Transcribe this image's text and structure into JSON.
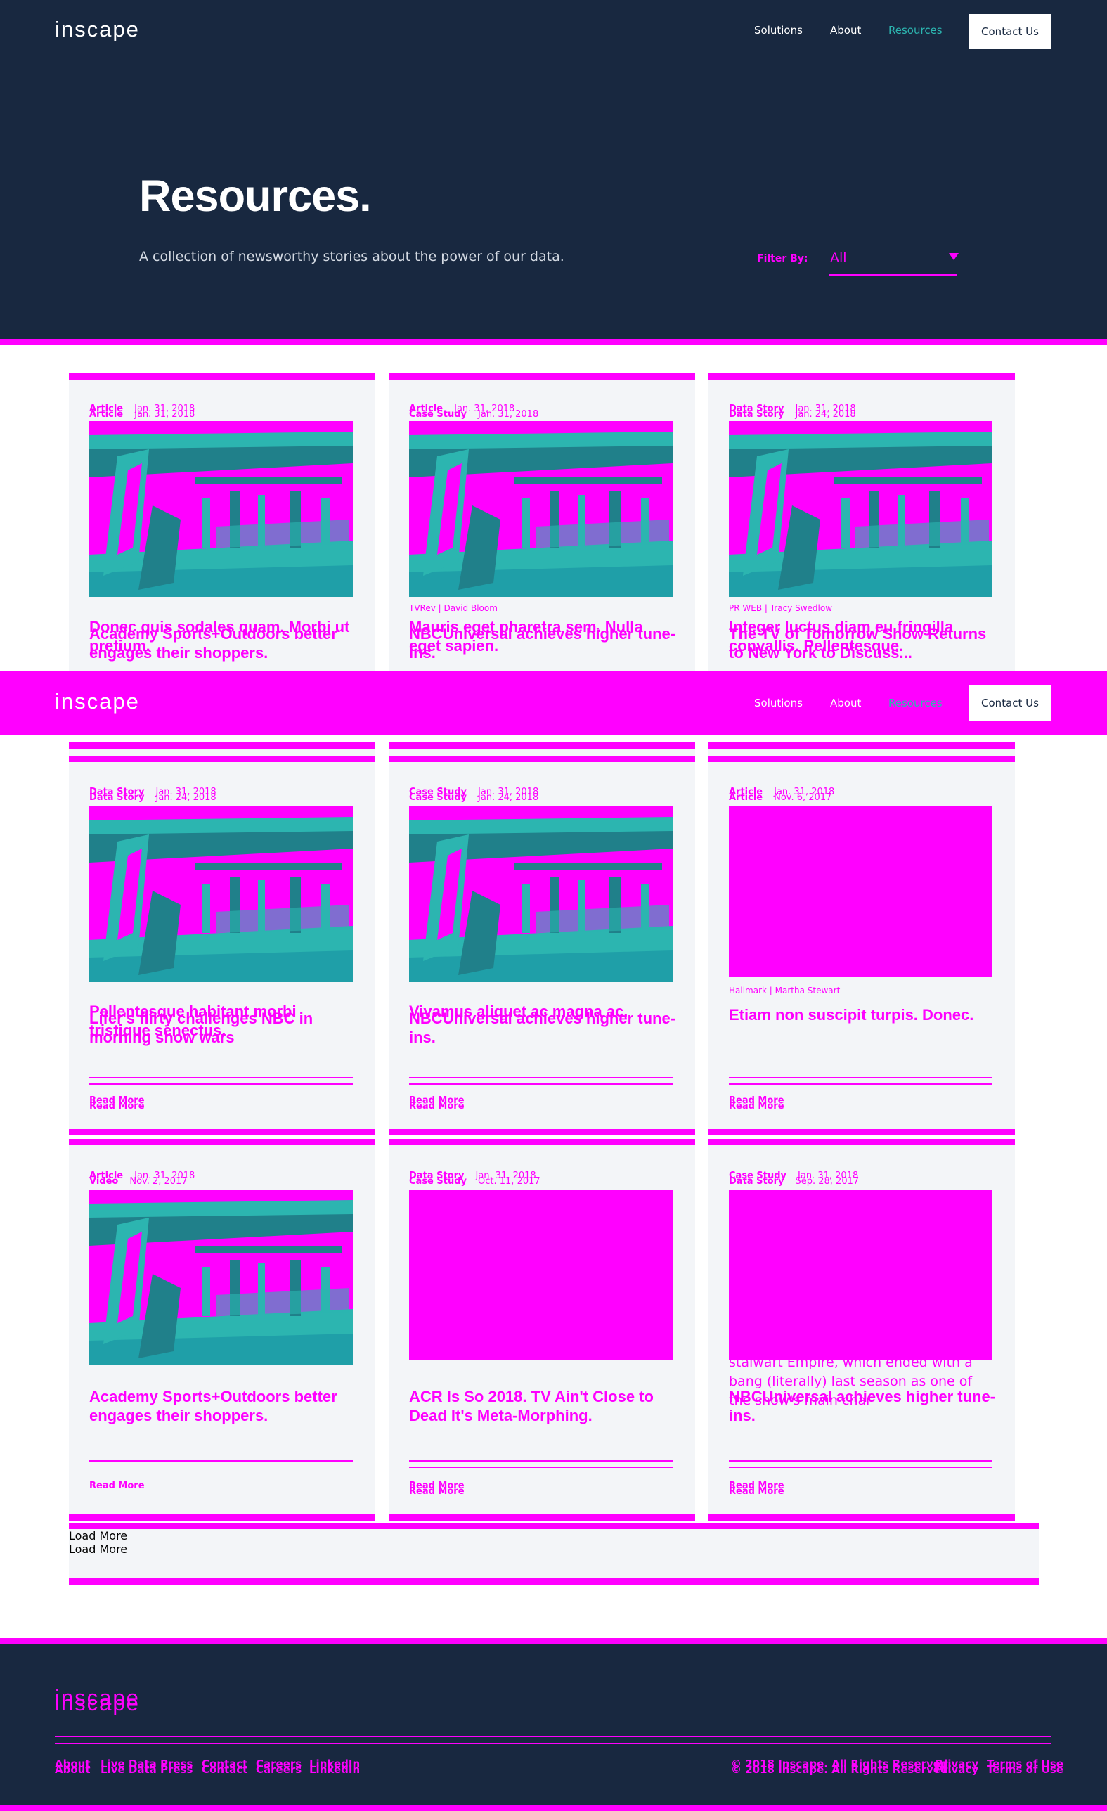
{
  "header": {
    "logo": "inscape",
    "nav": [
      "Solutions",
      "About",
      "Resources"
    ],
    "contact_button": "Contact Us",
    "title": "Resources.",
    "subtitle": "A collection of newsworthy stories about the power of our data.",
    "filter_label": "Filter By:",
    "filter_value": "All"
  },
  "cards": [
    {
      "meta_a": "Article",
      "date_a": "Jan. 31, 2018",
      "meta_b": "Article",
      "date_b": "Jan. 31, 2018",
      "source": "",
      "title_a": "Donec quis sodales quam. Morbi ut pretium.",
      "title_b": "Academy Sports+Outdoors better engages their shoppers."
    },
    {
      "meta_a": "Article",
      "date_a": "Jan. 31, 2018",
      "meta_b": "Case Study",
      "date_b": "Jan. 31, 2018",
      "source": "TVRev | David Bloom",
      "title_a": "Mauris eget pharetra sem. Nulla eget sapien.",
      "title_b": "NBCUniversal achieves higher tune-ins."
    },
    {
      "meta_a": "Data Story",
      "date_a": "Jan. 31, 2018",
      "meta_b": "Data Story",
      "date_b": "Jan. 24, 2018",
      "source": "PR WEB | Tracy Swedlow",
      "title_a": "Integer luctus diam eu fringilla convallis. Pellentesque.",
      "title_b": "The TV of Tomorrow Show Returns to New York to Discuss..."
    },
    {
      "meta_a": "Data Story",
      "date_a": "Jan. 31, 2018",
      "meta_b": "Data Story",
      "date_b": "Jan. 24, 2018",
      "source": "",
      "title_a": "Pellentesque habitant morbi tristique senectus.",
      "title_b": "Lifer's flirty challenges NBC in morning show wars"
    },
    {
      "meta_a": "Case Study",
      "date_a": "Jan. 31, 2018",
      "meta_b": "Case Study",
      "date_b": "Jan. 24, 2018",
      "source": "",
      "title_a": "Vivamus aliquet ac magna ac.",
      "title_b": "NBCUniversal achieves higher tune-ins."
    },
    {
      "meta_a": "Article",
      "date_a": "Jan. 31, 2018",
      "meta_b": "Article",
      "date_b": "Nov. 6, 2017",
      "source": "Hallmark | Martha Stewart",
      "title_a": "Etiam non suscipit turpis. Donec.",
      "title_b": ""
    },
    {
      "meta_a": "Article",
      "date_a": "Jan. 31, 2018",
      "meta_b": "Video",
      "date_b": "Nov. 2, 2017",
      "source": "",
      "title_a": "Academy Sports+Outdoors better engages their shoppers.",
      "title_b": ""
    },
    {
      "meta_a": "Data Story",
      "date_a": "Jan. 31, 2018",
      "meta_b": "Case Study",
      "date_b": "Oct. 11, 2017",
      "source": "",
      "title_a": "ACR Is So 2018. TV Ain't Close to Dead It's Meta-Morphing.",
      "title_b": ""
    },
    {
      "meta_a": "Case Study",
      "date_a": "Jan. 31, 2018",
      "meta_b": "Data Story",
      "date_b": "Sep. 28, 2017",
      "source": "",
      "title_a": "NBCUniversal achieves higher tune-ins.",
      "title_b": "",
      "excerpt": "stalwart Empire, which ended with a bang (literally) last season as one of the show's main char"
    }
  ],
  "read_more": "Read More",
  "load_more": "Load More",
  "footer": {
    "logo": "inscape",
    "links": [
      "About",
      "Live Data",
      "Press",
      "Contact",
      "Careers",
      "LinkedIn"
    ],
    "copyright": "© 2018 Inscape. All Rights Reserved.",
    "legal": [
      "Privacy",
      "Terms of Use"
    ]
  },
  "colors": {
    "navy": "#182840",
    "magenta": "#ff00ff",
    "teal": "#2cb5b0",
    "card": "#f3f5f8"
  }
}
